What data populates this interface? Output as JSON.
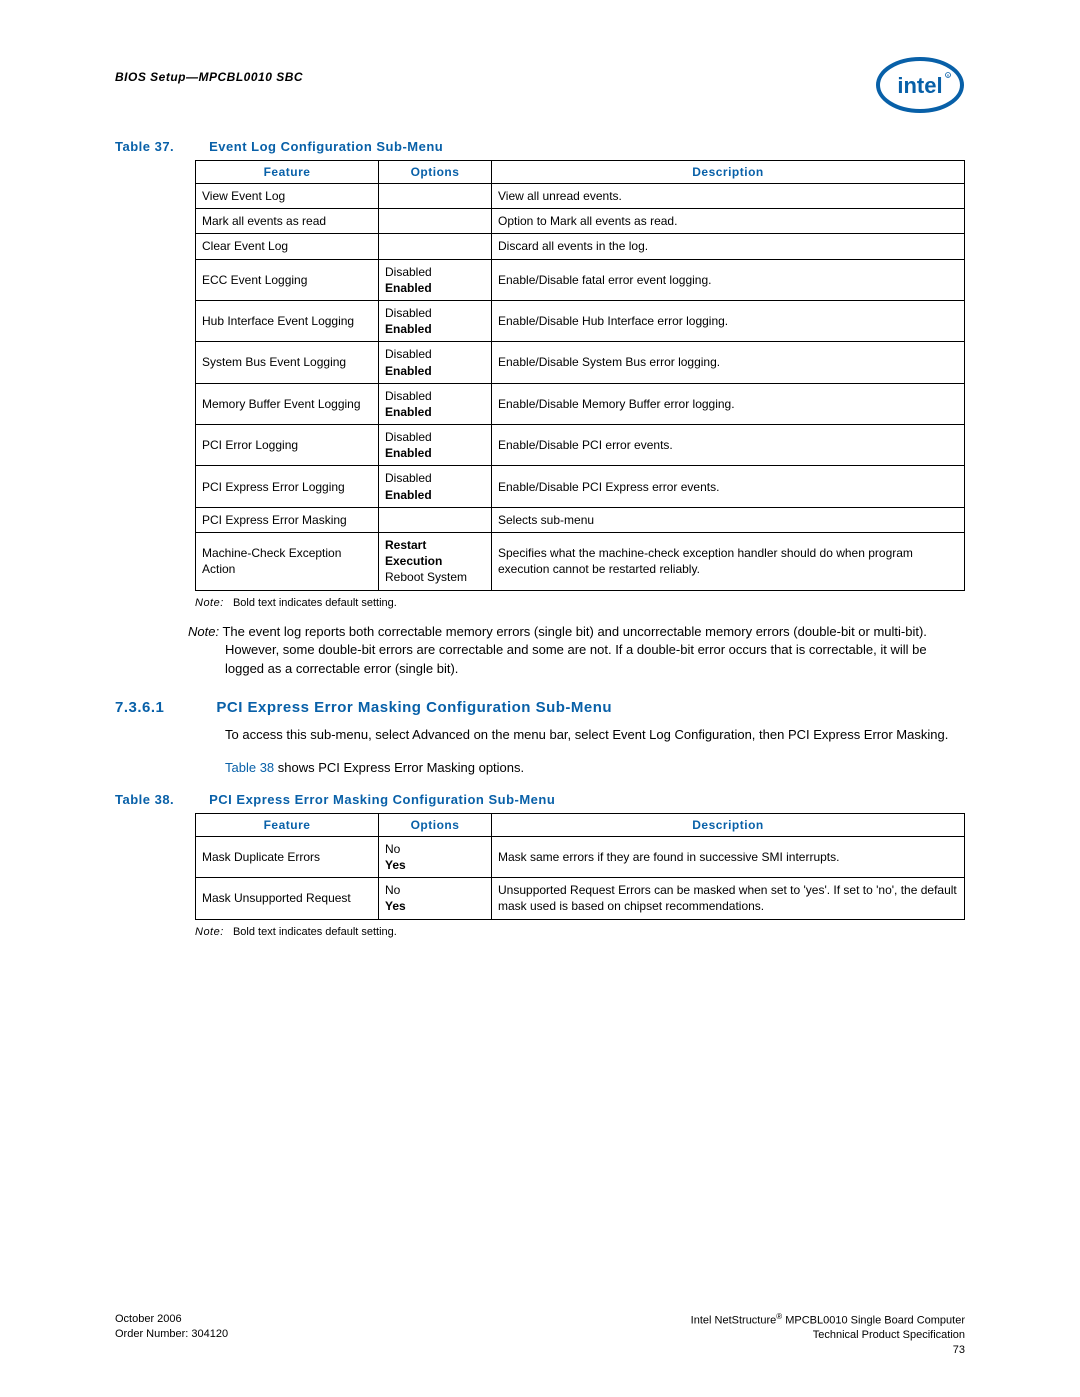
{
  "header": {
    "text": "BIOS Setup—MPCBL0010 SBC"
  },
  "table37": {
    "caption_label": "Table 37.",
    "caption_title": "Event Log Configuration Sub-Menu",
    "headers": {
      "feature": "Feature",
      "options": "Options",
      "description": "Description"
    },
    "rows": [
      {
        "feature": "View Event Log",
        "options": "",
        "description": "View all unread events."
      },
      {
        "feature": "Mark all events as read",
        "options": "",
        "description": "Option to Mark all events as read."
      },
      {
        "feature": "Clear Event Log",
        "options": "",
        "description": "Discard all events in the log."
      },
      {
        "feature": "ECC Event Logging",
        "opt1": "Disabled",
        "opt2": "Enabled",
        "description": "Enable/Disable fatal error event logging."
      },
      {
        "feature": "Hub Interface Event Logging",
        "opt1": "Disabled",
        "opt2": "Enabled",
        "description": "Enable/Disable Hub Interface error logging."
      },
      {
        "feature": "System Bus Event Logging",
        "opt1": "Disabled",
        "opt2": "Enabled",
        "description": "Enable/Disable System Bus error logging."
      },
      {
        "feature": "Memory Buffer Event Logging",
        "opt1": "Disabled",
        "opt2": "Enabled",
        "description": "Enable/Disable Memory Buffer error logging."
      },
      {
        "feature": "PCI Error Logging",
        "opt1": "Disabled",
        "opt2": "Enabled",
        "description": "Enable/Disable PCI error events."
      },
      {
        "feature": "PCI Express Error Logging",
        "opt1": "Disabled",
        "opt2": "Enabled",
        "description": "Enable/Disable PCI Express error events."
      },
      {
        "feature": "PCI Express Error Masking",
        "options": "",
        "description": "Selects sub-menu"
      },
      {
        "feature": "Machine-Check Exception Action",
        "opt1": "Restart Execution",
        "opt2": "Reboot System",
        "description": "Specifies what the machine-check exception handler should do when program execution cannot be restarted reliably."
      }
    ],
    "footnote_label": "Note:",
    "footnote_text": "Bold text indicates default setting."
  },
  "body_note": {
    "prefix": "Note:",
    "text": "The event log reports both correctable memory errors (single bit) and uncorrectable memory errors (double-bit or multi-bit). However, some double-bit errors are correctable and some are not. If a double-bit error occurs that is correctable, it will be logged as a correctable error (single bit)."
  },
  "section": {
    "num": "7.3.6.1",
    "title": "PCI Express Error Masking Configuration Sub-Menu"
  },
  "para1": "To access this sub-menu, select Advanced on the menu bar, select Event Log Configuration, then PCI Express Error Masking.",
  "para2_prefix": "Table 38",
  "para2_rest": " shows PCI Express Error Masking options.",
  "table38": {
    "caption_label": "Table 38.",
    "caption_title": "PCI Express Error Masking Configuration Sub-Menu",
    "headers": {
      "feature": "Feature",
      "options": "Options",
      "description": "Description"
    },
    "rows": [
      {
        "feature": "Mask Duplicate Errors",
        "opt1": "No",
        "opt2": "Yes",
        "description": "Mask same errors if they are found in successive SMI interrupts."
      },
      {
        "feature": "Mask Unsupported Request",
        "opt1": "No",
        "opt2": "Yes",
        "description": "Unsupported Request Errors can be masked when set to 'yes'. If set to 'no', the default mask used is based on chipset recommendations."
      }
    ],
    "footnote_label": "Note:",
    "footnote_text": "Bold text indicates default setting."
  },
  "footer": {
    "left1": "October 2006",
    "left2": "Order Number: 304120",
    "right1a": "Intel NetStructure",
    "right1b": " MPCBL0010 Single Board Computer",
    "right2": "Technical Product Specification",
    "right3": "73"
  }
}
